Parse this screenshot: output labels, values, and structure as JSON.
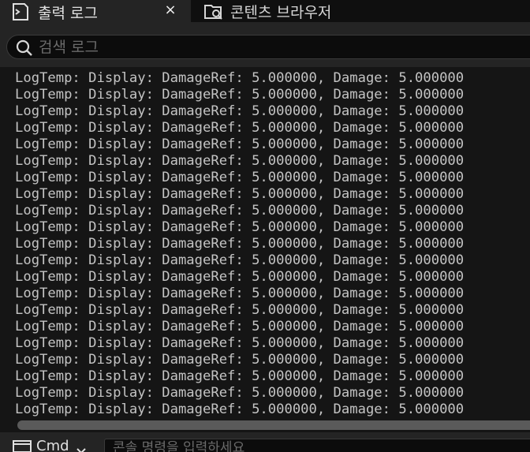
{
  "tabs": [
    {
      "label": "출력 로그",
      "icon": "output-log-icon",
      "active": true
    },
    {
      "label": "콘텐츠 브라우저",
      "icon": "content-browser-icon",
      "active": false
    }
  ],
  "tab_close_glyph": "×",
  "search": {
    "placeholder": "검색 로그",
    "value": ""
  },
  "log_lines": [
    "LogTemp: Display: DamageRef: 5.000000, Damage: 5.000000",
    "LogTemp: Display: DamageRef: 5.000000, Damage: 5.000000",
    "LogTemp: Display: DamageRef: 5.000000, Damage: 5.000000",
    "LogTemp: Display: DamageRef: 5.000000, Damage: 5.000000",
    "LogTemp: Display: DamageRef: 5.000000, Damage: 5.000000",
    "LogTemp: Display: DamageRef: 5.000000, Damage: 5.000000",
    "LogTemp: Display: DamageRef: 5.000000, Damage: 5.000000",
    "LogTemp: Display: DamageRef: 5.000000, Damage: 5.000000",
    "LogTemp: Display: DamageRef: 5.000000, Damage: 5.000000",
    "LogTemp: Display: DamageRef: 5.000000, Damage: 5.000000",
    "LogTemp: Display: DamageRef: 5.000000, Damage: 5.000000",
    "LogTemp: Display: DamageRef: 5.000000, Damage: 5.000000",
    "LogTemp: Display: DamageRef: 5.000000, Damage: 5.000000",
    "LogTemp: Display: DamageRef: 5.000000, Damage: 5.000000",
    "LogTemp: Display: DamageRef: 5.000000, Damage: 5.000000",
    "LogTemp: Display: DamageRef: 5.000000, Damage: 5.000000",
    "LogTemp: Display: DamageRef: 5.000000, Damage: 5.000000",
    "LogTemp: Display: DamageRef: 5.000000, Damage: 5.000000",
    "LogTemp: Display: DamageRef: 5.000000, Damage: 5.000000",
    "LogTemp: Display: DamageRef: 5.000000, Damage: 5.000000",
    "LogTemp: Display: DamageRef: 5.000000, Damage: 5.000000"
  ],
  "command": {
    "label": "Cmd",
    "placeholder": "콘솔 명령을 입력하세요",
    "value": ""
  },
  "colors": {
    "background": "#151515",
    "panel": "#242424",
    "text": "#c4c4c4"
  }
}
